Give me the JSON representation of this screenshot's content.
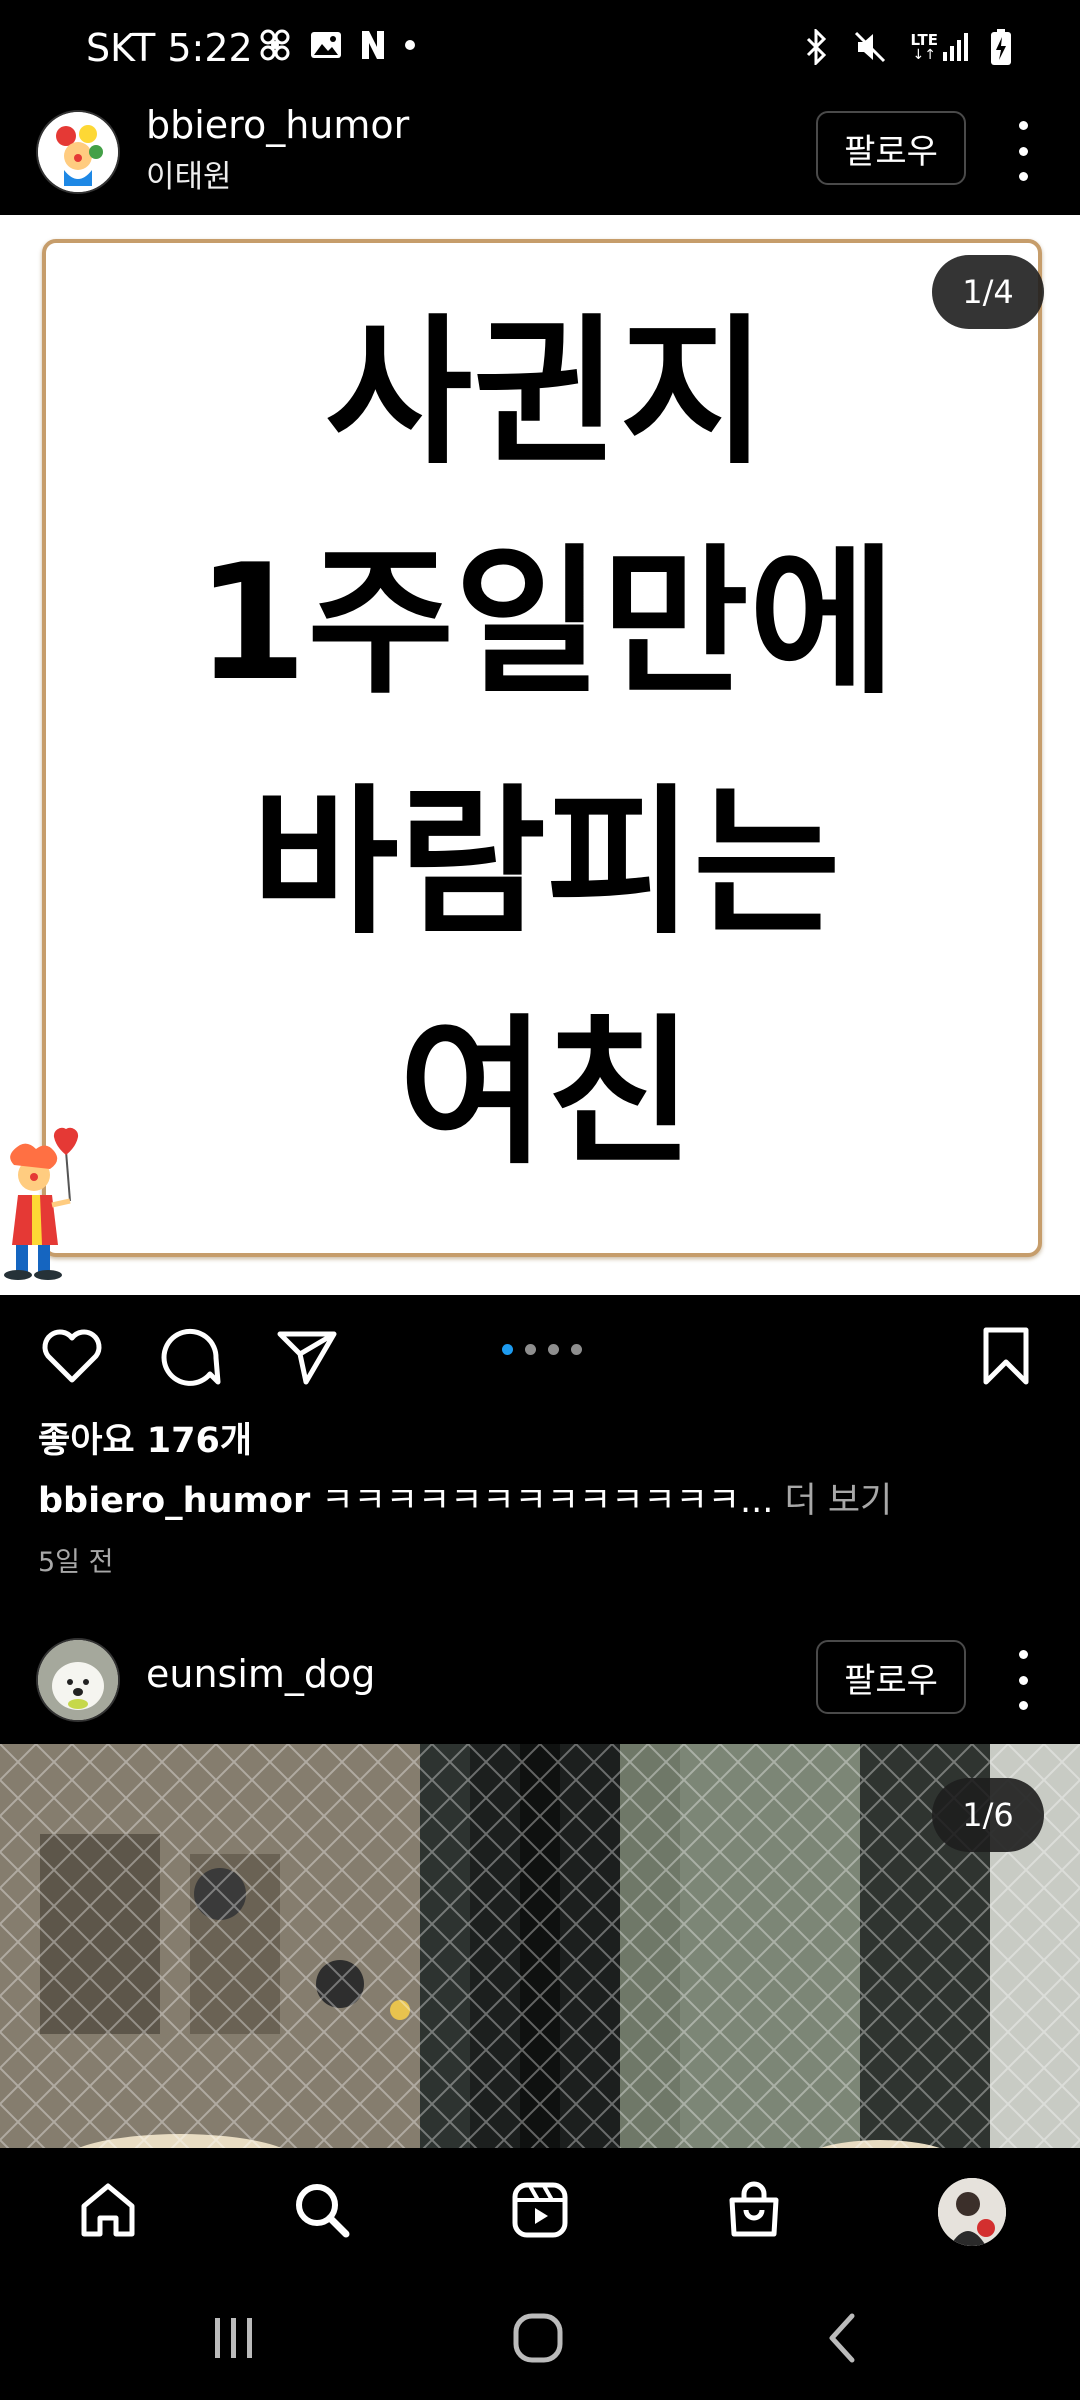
{
  "status_bar": {
    "carrier_time": "SKT 5:22",
    "left_icons": [
      "pinwheel-icon",
      "gallery-icon",
      "n-app-icon",
      "dot-icon"
    ],
    "right_icons": [
      "bluetooth-icon",
      "mute-icon",
      "lte-signal-icon",
      "battery-charging-icon"
    ],
    "lte_label": "LTE"
  },
  "post1": {
    "username": "bbiero_humor",
    "subtitle": "이태원",
    "follow_label": "팔로우",
    "counter": "1/4",
    "image_text": [
      "사귄지",
      "1주일만에",
      "바람피는",
      "여친"
    ],
    "carousel_dots": 4,
    "active_dot": 0,
    "likes": "좋아요 176개",
    "caption_user": "bbiero_humor",
    "caption_text": " ㅋㅋㅋㅋㅋㅋㅋㅋㅋㅋㅋㅋㅋ...",
    "caption_more": " 더 보기",
    "date": "5일 전"
  },
  "post2": {
    "username": "eunsim_dog",
    "follow_label": "팔로우",
    "counter": "1/6"
  },
  "bottom_nav": [
    "home-icon",
    "search-icon",
    "reels-icon",
    "shop-icon",
    "profile-avatar"
  ],
  "system_nav": [
    "recent-apps-icon",
    "home-circle-icon",
    "back-icon"
  ],
  "colors": {
    "background": "#000000",
    "accent_dot": "#1d9bf0",
    "card_border": "#c69d6b",
    "muted_text": "#a8a8a8"
  }
}
